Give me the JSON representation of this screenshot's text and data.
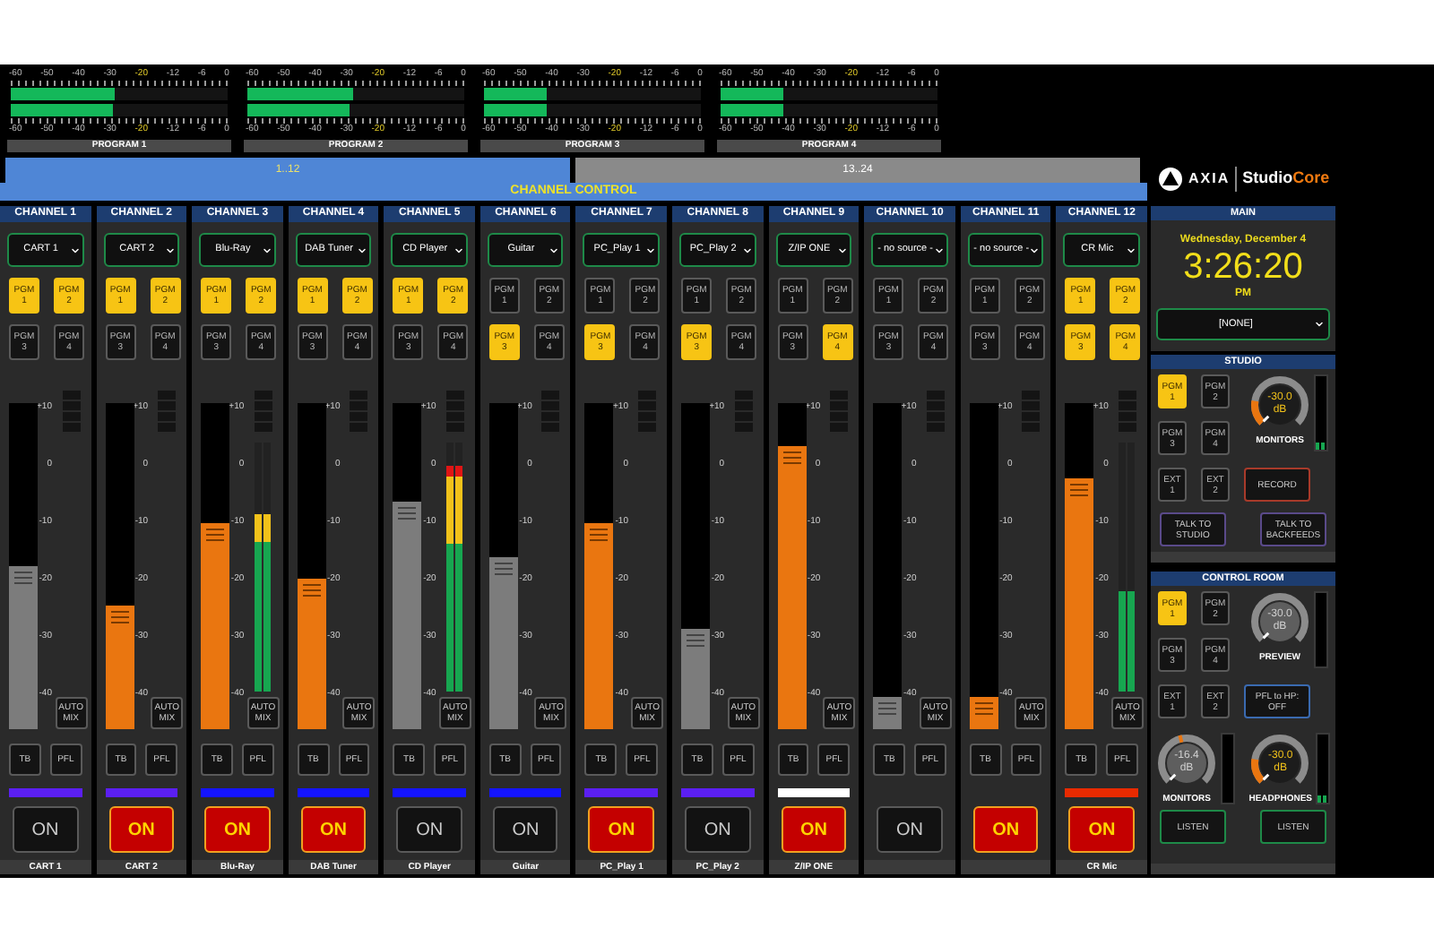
{
  "program_meters": [
    {
      "label": "PROGRAM 1",
      "bars": [
        {
          "level": 0.48
        },
        {
          "level": 0.47
        }
      ],
      "scale_top": [
        {
          "label": "-60",
          "warn": false
        },
        {
          "label": "-50",
          "warn": false
        },
        {
          "label": "-40",
          "warn": false
        },
        {
          "label": "-30",
          "warn": false
        },
        {
          "label": "-20",
          "warn": true
        },
        {
          "label": "-12",
          "warn": false
        },
        {
          "label": "-6",
          "warn": false
        },
        {
          "label": "0",
          "warn": false
        }
      ],
      "scale_bottom": [
        {
          "label": "-60",
          "warn": false
        },
        {
          "label": "-50",
          "warn": false
        },
        {
          "label": "-40",
          "warn": false
        },
        {
          "label": "-30",
          "warn": false
        },
        {
          "label": "-20",
          "warn": true
        },
        {
          "label": "-12",
          "warn": false
        },
        {
          "label": "-6",
          "warn": false
        },
        {
          "label": "0",
          "warn": false
        }
      ]
    },
    {
      "label": "PROGRAM 2",
      "bars": [
        {
          "level": 0.49
        },
        {
          "level": 0.47
        }
      ],
      "scale_top": [
        {
          "label": "-60",
          "warn": false
        },
        {
          "label": "-50",
          "warn": false
        },
        {
          "label": "-40",
          "warn": false
        },
        {
          "label": "-30",
          "warn": false
        },
        {
          "label": "-20",
          "warn": true
        },
        {
          "label": "-12",
          "warn": false
        },
        {
          "label": "-6",
          "warn": false
        },
        {
          "label": "0",
          "warn": false
        }
      ],
      "scale_bottom": [
        {
          "label": "-60",
          "warn": false
        },
        {
          "label": "-50",
          "warn": false
        },
        {
          "label": "-40",
          "warn": false
        },
        {
          "label": "-30",
          "warn": false
        },
        {
          "label": "-20",
          "warn": true
        },
        {
          "label": "-12",
          "warn": false
        },
        {
          "label": "-6",
          "warn": false
        },
        {
          "label": "0",
          "warn": false
        }
      ]
    },
    {
      "label": "PROGRAM 3",
      "bars": [
        {
          "level": 0.29
        },
        {
          "level": 0.29
        }
      ],
      "scale_top": [
        {
          "label": "-60",
          "warn": false
        },
        {
          "label": "-50",
          "warn": false
        },
        {
          "label": "-40",
          "warn": false
        },
        {
          "label": "-30",
          "warn": false
        },
        {
          "label": "-20",
          "warn": true
        },
        {
          "label": "-12",
          "warn": false
        },
        {
          "label": "-6",
          "warn": false
        },
        {
          "label": "0",
          "warn": false
        }
      ],
      "scale_bottom": [
        {
          "label": "-60",
          "warn": false
        },
        {
          "label": "-50",
          "warn": false
        },
        {
          "label": "-40",
          "warn": false
        },
        {
          "label": "-30",
          "warn": false
        },
        {
          "label": "-20",
          "warn": true
        },
        {
          "label": "-12",
          "warn": false
        },
        {
          "label": "-6",
          "warn": false
        },
        {
          "label": "0",
          "warn": false
        }
      ]
    },
    {
      "label": "PROGRAM 4",
      "bars": [
        {
          "level": 0.29
        },
        {
          "level": 0.29
        }
      ],
      "scale_top": [
        {
          "label": "-60",
          "warn": false
        },
        {
          "label": "-50",
          "warn": false
        },
        {
          "label": "-40",
          "warn": false
        },
        {
          "label": "-30",
          "warn": false
        },
        {
          "label": "-20",
          "warn": true
        },
        {
          "label": "-12",
          "warn": false
        },
        {
          "label": "-6",
          "warn": false
        },
        {
          "label": "0",
          "warn": false
        }
      ],
      "scale_bottom": [
        {
          "label": "-60",
          "warn": false
        },
        {
          "label": "-50",
          "warn": false
        },
        {
          "label": "-40",
          "warn": false
        },
        {
          "label": "-30",
          "warn": false
        },
        {
          "label": "-20",
          "warn": true
        },
        {
          "label": "-12",
          "warn": false
        },
        {
          "label": "-6",
          "warn": false
        },
        {
          "label": "0",
          "warn": false
        }
      ]
    }
  ],
  "tabs": [
    {
      "label": "1..12",
      "selected": true
    },
    {
      "label": "13..24",
      "selected": false
    }
  ],
  "section_title": "CHANNEL CONTROL",
  "logo": {
    "brand": "AXIA",
    "product": "Studio",
    "product_accent": "Core"
  },
  "channels": [
    {
      "title": "CHANNEL 1",
      "source": "CART 1",
      "pgm": [
        {
          "label": "PGM",
          "number": "1",
          "selected": true
        },
        {
          "label": "PGM",
          "number": "2",
          "selected": true
        },
        {
          "label": "PGM",
          "number": "3",
          "selected": false
        },
        {
          "label": "PGM",
          "number": "4",
          "selected": false
        }
      ],
      "scale": [
        "+10",
        "0",
        "-10",
        "-20",
        "-30",
        "-40"
      ],
      "fader": {
        "level": 0.5
      },
      "auto_mix": "AUTO MIX",
      "tb": "TB",
      "pfl": "PFL",
      "color": "#5b1ff2",
      "on_button": {
        "label": "ON",
        "on": false
      },
      "name": "CART 1"
    },
    {
      "title": "CHANNEL 2",
      "source": "CART 2",
      "pgm": [
        {
          "label": "PGM",
          "number": "1",
          "selected": true
        },
        {
          "label": "PGM",
          "number": "2",
          "selected": true
        },
        {
          "label": "PGM",
          "number": "3",
          "selected": false
        },
        {
          "label": "PGM",
          "number": "4",
          "selected": false
        }
      ],
      "scale": [
        "+10",
        "0",
        "-10",
        "-20",
        "-30",
        "-40"
      ],
      "fader": {
        "level": 0.38
      },
      "auto_mix": "AUTO MIX",
      "tb": "TB",
      "pfl": "PFL",
      "color": "#5b1ff2",
      "on_button": {
        "label": "ON",
        "on": true
      },
      "name": "CART 2"
    },
    {
      "title": "CHANNEL 3",
      "source": "Blu-Ray",
      "pgm": [
        {
          "label": "PGM",
          "number": "1",
          "selected": true
        },
        {
          "label": "PGM",
          "number": "2",
          "selected": true
        },
        {
          "label": "PGM",
          "number": "3",
          "selected": false
        },
        {
          "label": "PGM",
          "number": "4",
          "selected": false
        }
      ],
      "scale": [
        "+10",
        "0",
        "-10",
        "-20",
        "-30",
        "-40"
      ],
      "fader": {
        "level": 0.63
      },
      "meter": {
        "level": 0.71
      },
      "auto_mix": "AUTO MIX",
      "tb": "TB",
      "pfl": "PFL",
      "color": "#1414ff",
      "on_button": {
        "label": "ON",
        "on": true
      },
      "name": "Blu-Ray"
    },
    {
      "title": "CHANNEL 4",
      "source": "DAB Tuner",
      "pgm": [
        {
          "label": "PGM",
          "number": "1",
          "selected": true
        },
        {
          "label": "PGM",
          "number": "2",
          "selected": true
        },
        {
          "label": "PGM",
          "number": "3",
          "selected": false
        },
        {
          "label": "PGM",
          "number": "4",
          "selected": false
        }
      ],
      "scale": [
        "+10",
        "0",
        "-10",
        "-20",
        "-30",
        "-40"
      ],
      "fader": {
        "level": 0.46
      },
      "auto_mix": "AUTO MIX",
      "tb": "TB",
      "pfl": "PFL",
      "color": "#1414ff",
      "on_button": {
        "label": "ON",
        "on": true
      },
      "name": "DAB Tuner"
    },
    {
      "title": "CHANNEL 5",
      "source": "CD Player",
      "pgm": [
        {
          "label": "PGM",
          "number": "1",
          "selected": true
        },
        {
          "label": "PGM",
          "number": "2",
          "selected": true
        },
        {
          "label": "PGM",
          "number": "3",
          "selected": false
        },
        {
          "label": "PGM",
          "number": "4",
          "selected": false
        }
      ],
      "scale": [
        "+10",
        "0",
        "-10",
        "-20",
        "-30",
        "-40"
      ],
      "fader": {
        "level": 0.7
      },
      "meter": {
        "level": 0.91
      },
      "auto_mix": "AUTO MIX",
      "tb": "TB",
      "pfl": "PFL",
      "color": "#1414ff",
      "on_button": {
        "label": "ON",
        "on": false
      },
      "name": "CD Player"
    },
    {
      "title": "CHANNEL 6",
      "source": "Guitar",
      "pgm": [
        {
          "label": "PGM",
          "number": "1",
          "selected": false
        },
        {
          "label": "PGM",
          "number": "2",
          "selected": false
        },
        {
          "label": "PGM",
          "number": "3",
          "selected": true
        },
        {
          "label": "PGM",
          "number": "4",
          "selected": false
        }
      ],
      "scale": [
        "+10",
        "0",
        "-10",
        "-20",
        "-30",
        "-40"
      ],
      "fader": {
        "level": 0.53
      },
      "auto_mix": "AUTO MIX",
      "tb": "TB",
      "pfl": "PFL",
      "color": "#1414ff",
      "on_button": {
        "label": "ON",
        "on": false
      },
      "name": "Guitar"
    },
    {
      "title": "CHANNEL 7",
      "source": "PC_Play 1",
      "pgm": [
        {
          "label": "PGM",
          "number": "1",
          "selected": false
        },
        {
          "label": "PGM",
          "number": "2",
          "selected": false
        },
        {
          "label": "PGM",
          "number": "3",
          "selected": true
        },
        {
          "label": "PGM",
          "number": "4",
          "selected": false
        }
      ],
      "scale": [
        "+10",
        "0",
        "-10",
        "-20",
        "-30",
        "-40"
      ],
      "fader": {
        "level": 0.63
      },
      "auto_mix": "AUTO MIX",
      "tb": "TB",
      "pfl": "PFL",
      "color": "#5b1ff2",
      "on_button": {
        "label": "ON",
        "on": true
      },
      "name": "PC_Play 1"
    },
    {
      "title": "CHANNEL 8",
      "source": "PC_Play 2",
      "pgm": [
        {
          "label": "PGM",
          "number": "1",
          "selected": false
        },
        {
          "label": "PGM",
          "number": "2",
          "selected": false
        },
        {
          "label": "PGM",
          "number": "3",
          "selected": true
        },
        {
          "label": "PGM",
          "number": "4",
          "selected": false
        }
      ],
      "scale": [
        "+10",
        "0",
        "-10",
        "-20",
        "-30",
        "-40"
      ],
      "fader": {
        "level": 0.31
      },
      "auto_mix": "AUTO MIX",
      "tb": "TB",
      "pfl": "PFL",
      "color": "#5b1ff2",
      "on_button": {
        "label": "ON",
        "on": false
      },
      "name": "PC_Play 2"
    },
    {
      "title": "CHANNEL 9",
      "source": "Z/IP ONE",
      "pgm": [
        {
          "label": "PGM",
          "number": "1",
          "selected": false
        },
        {
          "label": "PGM",
          "number": "2",
          "selected": false
        },
        {
          "label": "PGM",
          "number": "3",
          "selected": false
        },
        {
          "label": "PGM",
          "number": "4",
          "selected": true
        }
      ],
      "scale": [
        "+10",
        "0",
        "-10",
        "-20",
        "-30",
        "-40"
      ],
      "fader": {
        "level": 0.87
      },
      "auto_mix": "AUTO MIX",
      "tb": "TB",
      "pfl": "PFL",
      "color": "#ffffff",
      "on_button": {
        "label": "ON",
        "on": true
      },
      "name": "Z/IP ONE"
    },
    {
      "title": "CHANNEL 10",
      "source": "- no source -",
      "pgm": [
        {
          "label": "PGM",
          "number": "1",
          "selected": false
        },
        {
          "label": "PGM",
          "number": "2",
          "selected": false
        },
        {
          "label": "PGM",
          "number": "3",
          "selected": false
        },
        {
          "label": "PGM",
          "number": "4",
          "selected": false
        }
      ],
      "scale": [
        "+10",
        "0",
        "-10",
        "-20",
        "-30",
        "-40"
      ],
      "fader": {
        "level": 0.1
      },
      "auto_mix": "AUTO MIX",
      "tb": "TB",
      "pfl": "PFL",
      "on_button": {
        "label": "ON",
        "on": false
      }
    },
    {
      "title": "CHANNEL 11",
      "source": "- no source -",
      "pgm": [
        {
          "label": "PGM",
          "number": "1",
          "selected": false
        },
        {
          "label": "PGM",
          "number": "2",
          "selected": false
        },
        {
          "label": "PGM",
          "number": "3",
          "selected": false
        },
        {
          "label": "PGM",
          "number": "4",
          "selected": false
        }
      ],
      "scale": [
        "+10",
        "0",
        "-10",
        "-20",
        "-30",
        "-40"
      ],
      "fader": {
        "level": 0.1
      },
      "auto_mix": "AUTO MIX",
      "tb": "TB",
      "pfl": "PFL",
      "on_button": {
        "label": "ON",
        "on": true
      }
    },
    {
      "title": "CHANNEL 12",
      "source": "CR Mic",
      "pgm": [
        {
          "label": "PGM",
          "number": "1",
          "selected": true
        },
        {
          "label": "PGM",
          "number": "2",
          "selected": true
        },
        {
          "label": "PGM",
          "number": "3",
          "selected": true
        },
        {
          "label": "PGM",
          "number": "4",
          "selected": true
        }
      ],
      "scale": [
        "+10",
        "0",
        "-10",
        "-20",
        "-30",
        "-40"
      ],
      "fader": {
        "level": 0.77
      },
      "meter": {
        "level": 0.4
      },
      "auto_mix": "AUTO MIX",
      "tb": "TB",
      "pfl": "PFL",
      "color": "#e82a00",
      "on_button": {
        "label": "ON",
        "on": true
      },
      "name": "CR Mic"
    }
  ],
  "main": {
    "title": "MAIN",
    "date": "Wednesday, December 4",
    "time": "3:26:20",
    "meridiem": "PM",
    "source": "[NONE]"
  },
  "studio": {
    "title": "STUDIO",
    "buttons": [
      {
        "label": "PGM",
        "number": "1",
        "selected": true
      },
      {
        "label": "PGM",
        "number": "2",
        "selected": false
      },
      {
        "label": "PGM",
        "number": "3",
        "selected": false
      },
      {
        "label": "PGM",
        "number": "4",
        "selected": false
      },
      {
        "label": "EXT",
        "number": "1",
        "selected": false
      },
      {
        "label": "EXT",
        "number": "2",
        "selected": false
      }
    ],
    "knob": {
      "reading": "-30.0",
      "unit": "dB",
      "label": "MONITORS",
      "level": 0.2,
      "active": true
    },
    "meter": {
      "level": 0.1
    },
    "record": "RECORD",
    "talk_buttons": [
      "TALK TO STUDIO",
      "TALK TO BACKFEEDS"
    ]
  },
  "control_room": {
    "title": "CONTROL ROOM",
    "buttons": [
      {
        "label": "PGM",
        "number": "1",
        "selected": true
      },
      {
        "label": "PGM",
        "number": "2",
        "selected": false
      },
      {
        "label": "PGM",
        "number": "3",
        "selected": false
      },
      {
        "label": "PGM",
        "number": "4",
        "selected": false
      },
      {
        "label": "EXT",
        "number": "1",
        "selected": false
      },
      {
        "label": "EXT",
        "number": "2",
        "selected": false
      }
    ],
    "preview_knob": {
      "reading": "-30.0",
      "unit": "dB",
      "label": "PREVIEW",
      "active": false
    },
    "pfl_button": "PFL to HP: OFF",
    "knobs": [
      {
        "reading": "-16.4",
        "unit": "dB",
        "label": "MONITORS",
        "level": 0.45,
        "active": false
      },
      {
        "reading": "-30.0",
        "unit": "dB",
        "label": "HEADPHONES",
        "level": 0.2,
        "active": true,
        "meter": {
          "level": 0.1
        }
      }
    ],
    "listen_buttons": [
      "LISTEN",
      "LISTEN"
    ]
  }
}
